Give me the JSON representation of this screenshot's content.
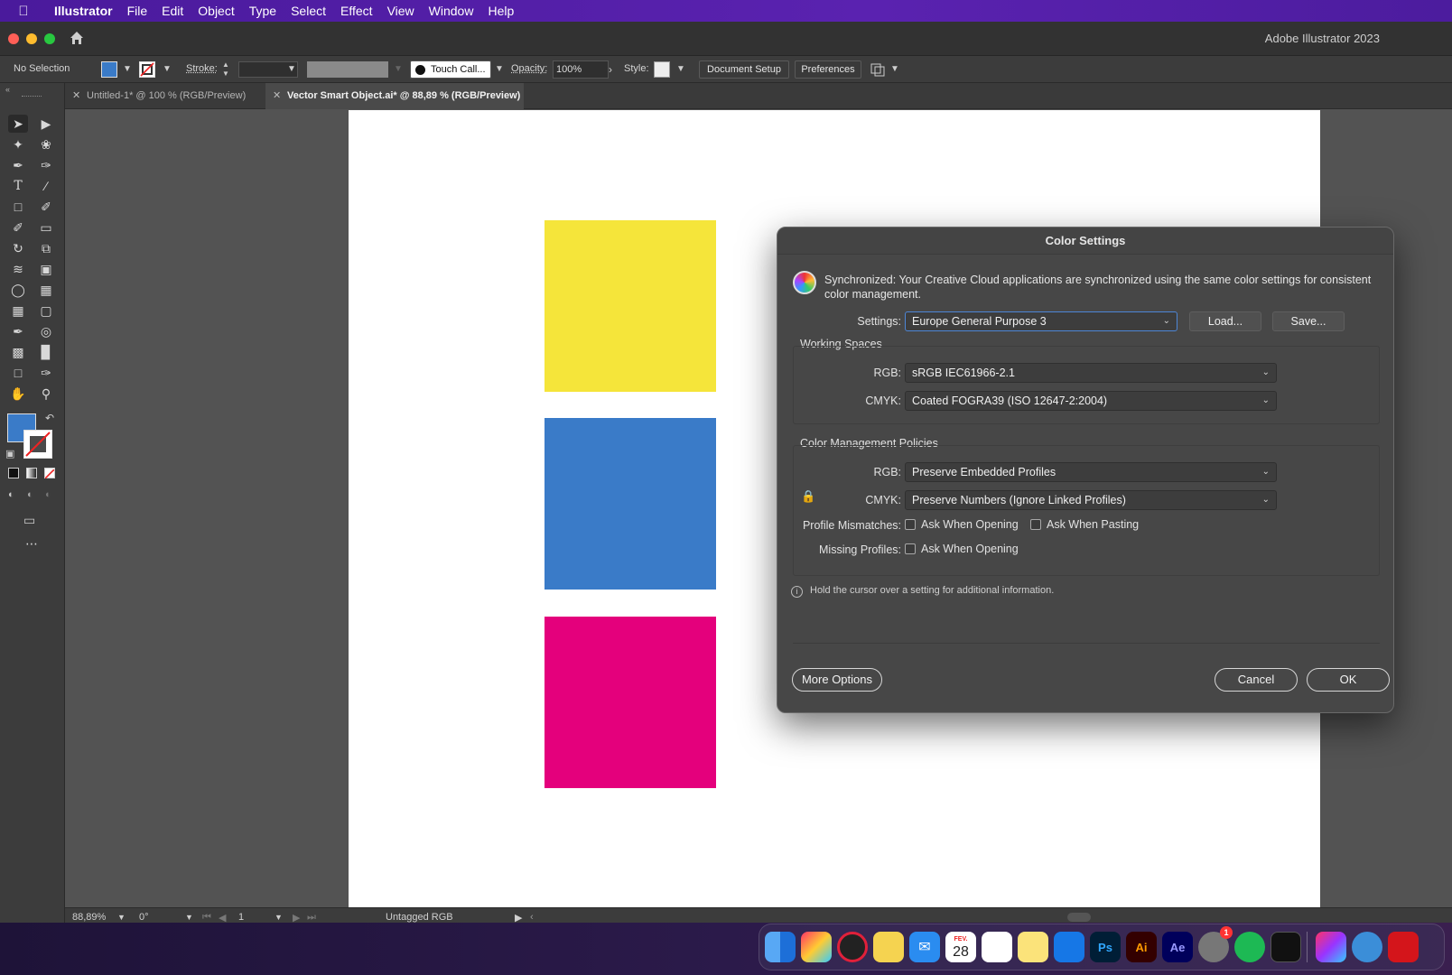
{
  "menubar": {
    "app": "Illustrator",
    "items": [
      "File",
      "Edit",
      "Object",
      "Type",
      "Select",
      "Effect",
      "View",
      "Window",
      "Help"
    ]
  },
  "titlebar": {
    "title": "Adobe Illustrator 2023"
  },
  "controlbar": {
    "selection": "No Selection",
    "stroke_label": "Stroke:",
    "brush": "Touch Call...",
    "opacity_label": "Opacity:",
    "opacity_value": "100%",
    "style_label": "Style:",
    "document_setup": "Document Setup",
    "preferences": "Preferences"
  },
  "tabs": [
    {
      "label": "Untitled-1* @ 100 % (RGB/Preview)",
      "active": false
    },
    {
      "label": "Vector Smart Object.ai* @ 88,89 % (RGB/Preview)",
      "active": true
    }
  ],
  "artboard": {
    "swatches": [
      {
        "color": "#F5E53A"
      },
      {
        "color": "#3A7BC8"
      },
      {
        "color": "#E4007C"
      }
    ]
  },
  "statusbar": {
    "zoom": "88,89%",
    "rotation": "0°",
    "artboard_number": "1",
    "profile": "Untagged RGB"
  },
  "dialog": {
    "title": "Color Settings",
    "sync_message": "Synchronized: Your Creative Cloud applications are synchronized using the same color settings for consistent color management.",
    "settings_label": "Settings:",
    "settings_value": "Europe General Purpose 3",
    "load_button": "Load...",
    "save_button": "Save...",
    "working_spaces": {
      "title": "Working Spaces",
      "rgb_label": "RGB:",
      "rgb_value": "sRGB IEC61966-2.1",
      "cmyk_label": "CMYK:",
      "cmyk_value": "Coated FOGRA39 (ISO 12647-2:2004)"
    },
    "policies": {
      "title": "Color Management Policies",
      "rgb_label": "RGB:",
      "rgb_value": "Preserve Embedded Profiles",
      "cmyk_label": "CMYK:",
      "cmyk_value": "Preserve Numbers (Ignore Linked Profiles)",
      "mismatches_label": "Profile Mismatches:",
      "ask_opening": "Ask When Opening",
      "ask_pasting": "Ask When Pasting",
      "missing_label": "Missing Profiles:",
      "missing_ask_opening": "Ask When Opening"
    },
    "info_text": "Hold the cursor over a setting for additional information.",
    "more_options": "More Options",
    "cancel": "Cancel",
    "ok": "OK"
  },
  "dock": {
    "calendar_month": "FEV.",
    "calendar_day": "28",
    "photoshop": "Ps",
    "illustrator": "Ai",
    "after_effects": "Ae",
    "settings_badge": "1"
  },
  "colors": {
    "fill": "#3A7BC8",
    "accent": "#E4007C"
  }
}
